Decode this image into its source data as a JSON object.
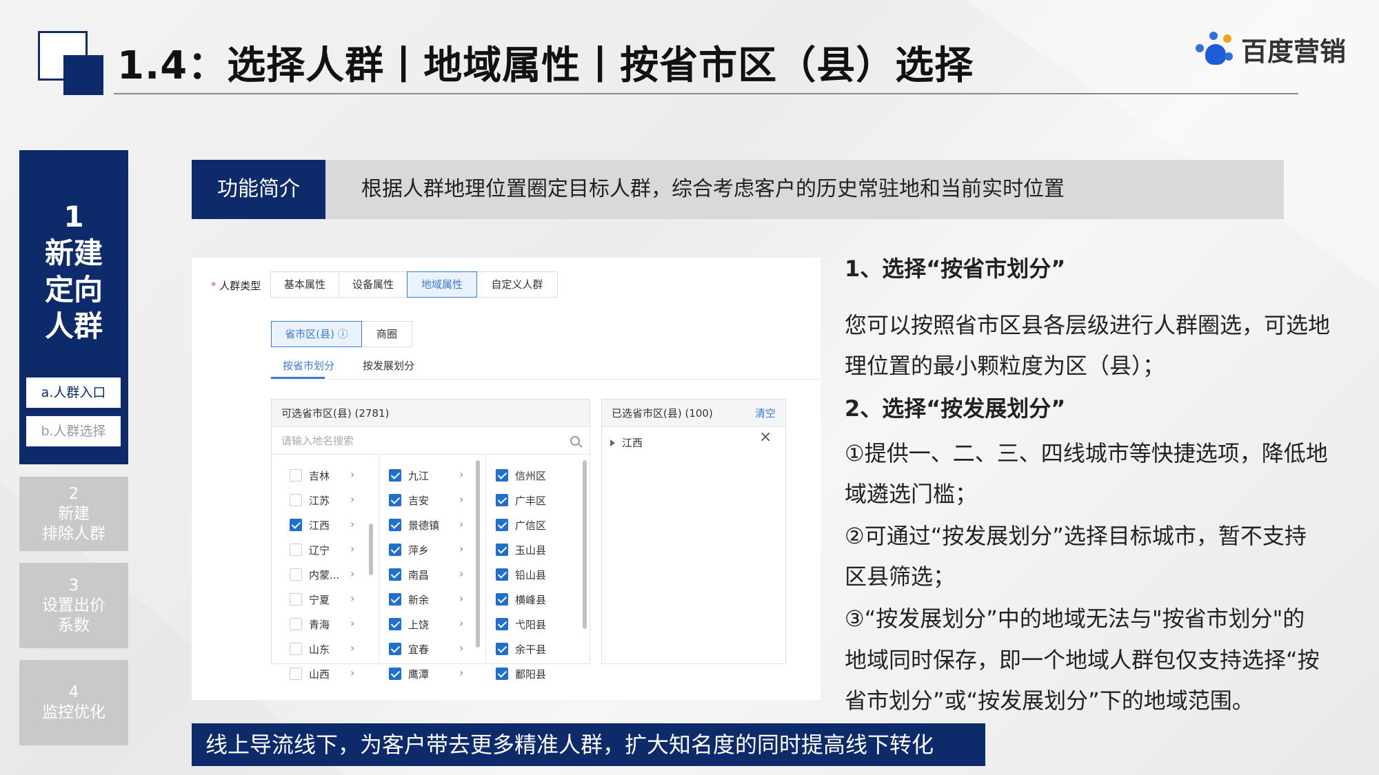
{
  "header": {
    "title": "1.4：选择人群丨地域属性丨按省市区（县）选择",
    "brand": "百度营销"
  },
  "nav": {
    "step1_title": "1\n新建\n定向\n人群",
    "step1_sub_a": "a.人群入口",
    "step1_sub_b": "b.人群选择",
    "step2": "2\n新建\n排除人群",
    "step3": "3\n设置出价\n系数",
    "step4": "4\n监控优化"
  },
  "intro": {
    "label": "功能简介",
    "text": "根据人群地理位置圈定目标人群，综合考虑客户的历史常驻地和当前实时位置"
  },
  "screenshot": {
    "crowd_type_req": "*",
    "crowd_type_label": "人群类型",
    "tabs": [
      "基本属性",
      "设备属性",
      "地域属性",
      "自定义人群"
    ],
    "mode_btns": [
      "省市区(县) ⓘ",
      "商圈"
    ],
    "subtabs": [
      "按省市划分",
      "按发展划分"
    ],
    "available_title": "可选省市区(县) (2781)",
    "search_placeholder": "请输入地名搜索",
    "provinces": [
      {
        "name": "吉林",
        "checked": false
      },
      {
        "name": "江苏",
        "checked": false
      },
      {
        "name": "江西",
        "checked": true
      },
      {
        "name": "辽宁",
        "checked": false
      },
      {
        "name": "内蒙...",
        "checked": false
      },
      {
        "name": "宁夏",
        "checked": false
      },
      {
        "name": "青海",
        "checked": false
      },
      {
        "name": "山东",
        "checked": false
      },
      {
        "name": "山西",
        "checked": false
      }
    ],
    "cities": [
      "九江",
      "吉安",
      "景德镇",
      "萍乡",
      "南昌",
      "新余",
      "上饶",
      "宜春",
      "鹰潭"
    ],
    "districts": [
      "信州区",
      "广丰区",
      "广信区",
      "玉山县",
      "铅山县",
      "横峰县",
      "弋阳县",
      "余干县",
      "鄱阳县"
    ],
    "selected_title": "已选省市区(县) (100)",
    "clear_label": "清空",
    "selected_items": [
      "江西"
    ]
  },
  "right_text": {
    "h1": "1、选择“按省市划分”",
    "p1a": "您可以按照省市区县各层级进行人群圈选，可选地",
    "p1b": "理位置的最小颗粒度为区（县）；",
    "h2": "2、选择“按发展划分”",
    "p2a": "①提供一、二、三、四线城市等快捷选项，降低地",
    "p2b": "域遴选门槛；",
    "p3a": "②可通过“按发展划分”选择目标城市，暂不支持",
    "p3b": "区县筛选；",
    "p4a": "③“按发展划分”中的地域无法与\"按省市划分\"的",
    "p4b": "地域同时保存，即一个地域人群包仅支持选择“按",
    "p4c": "省市划分”或“按发展划分”下的地域范围。"
  },
  "banner": "线上导流线下，为客户带去更多精准人群，扩大知名度的同时提高线下转化",
  "colors": {
    "navy": "#0d2a6b",
    "accent_blue": "#3a7bd5",
    "gray_nav": "#c9c9c9"
  }
}
